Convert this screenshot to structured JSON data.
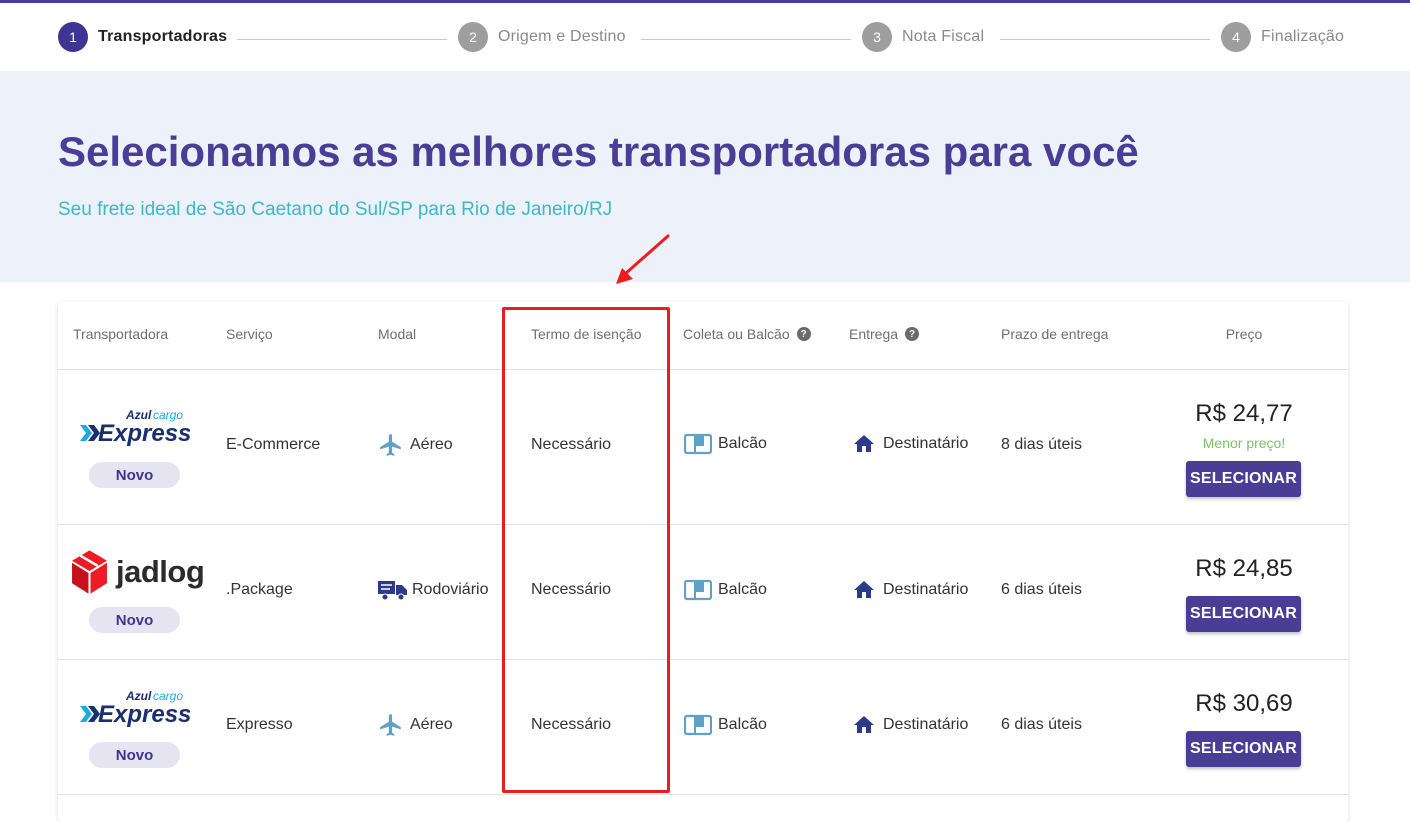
{
  "stepper": {
    "steps": [
      {
        "num": "1",
        "label": "Transportadoras"
      },
      {
        "num": "2",
        "label": "Origem e Destino"
      },
      {
        "num": "3",
        "label": "Nota Fiscal"
      },
      {
        "num": "4",
        "label": "Finalização"
      }
    ]
  },
  "hero": {
    "title": "Selecionamos as melhores transportadoras para você",
    "subtitle": "Seu frete ideal de São Caetano do Sul/SP para Rio de Janeiro/RJ"
  },
  "table": {
    "headers": {
      "carrier": "Transportadora",
      "service": "Serviço",
      "modal": "Modal",
      "exemption": "Termo de isenção",
      "pickup": "Coleta ou Balcão",
      "delivery": "Entrega",
      "deadline": "Prazo de entrega",
      "price": "Preço"
    },
    "help_icon": "?",
    "rows": [
      {
        "carrier_logo": {
          "azul_small": "Azul",
          "cargo": "cargo",
          "express": "Express"
        },
        "badge": "Novo",
        "service": "E-Commerce",
        "modal": "Aéreo",
        "modal_icon": "airplane-icon",
        "exemption": "Necessário",
        "pickup": "Balcão",
        "delivery": "Destinatário",
        "deadline": "8 dias úteis",
        "price": "R$ 24,77",
        "tag": "Menor preço!",
        "button": "SELECIONAR"
      },
      {
        "carrier_logo": {
          "name": "jadlog"
        },
        "badge": "Novo",
        "service": ".Package",
        "modal": "Rodoviário",
        "modal_icon": "truck-icon",
        "exemption": "Necessário",
        "pickup": "Balcão",
        "delivery": "Destinatário",
        "deadline": "6 dias úteis",
        "price": "R$ 24,85",
        "button": "SELECIONAR"
      },
      {
        "carrier_logo": {
          "azul_small": "Azul",
          "cargo": "cargo",
          "express": "Express"
        },
        "badge": "Novo",
        "service": "Expresso",
        "modal": "Aéreo",
        "modal_icon": "airplane-icon",
        "exemption": "Necessário",
        "pickup": "Balcão",
        "delivery": "Destinatário",
        "deadline": "6 dias úteis",
        "price": "R$ 30,69",
        "button": "SELECIONAR"
      }
    ]
  },
  "colors": {
    "brand": "#4a3d96",
    "accent": "#3eb7c6",
    "success": "#7cc067",
    "annotation": "#ee1c1c"
  }
}
